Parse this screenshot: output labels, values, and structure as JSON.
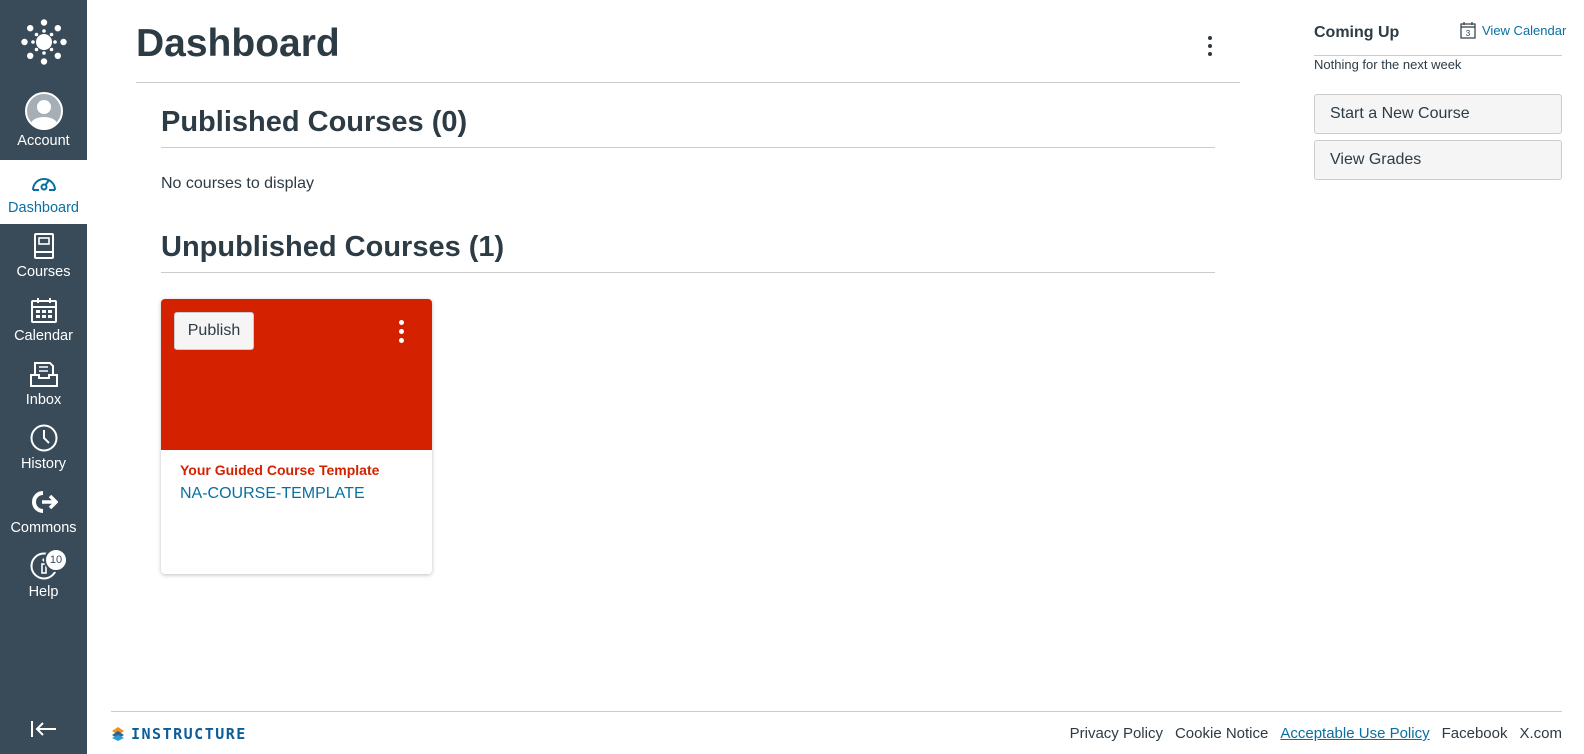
{
  "nav": {
    "account": "Account",
    "dashboard": "Dashboard",
    "courses": "Courses",
    "calendar": "Calendar",
    "inbox": "Inbox",
    "history": "History",
    "commons": "Commons",
    "help": "Help",
    "help_badge": "10"
  },
  "main": {
    "title": "Dashboard",
    "published_heading": "Published Courses (0)",
    "published_empty": "No courses to display",
    "unpublished_heading": "Unpublished Courses (1)"
  },
  "course_card": {
    "publish_label": "Publish",
    "title": "Your Guided Course Template",
    "code": "NA-COURSE-TEMPLATE",
    "color": "#d42200"
  },
  "sidebar_right": {
    "coming_up": "Coming Up",
    "calendar_day": "3",
    "view_calendar": "View Calendar",
    "nothing": "Nothing for the next week",
    "start_course": "Start a New Course",
    "view_grades": "View Grades"
  },
  "footer": {
    "logo_text": "INSTRUCTURE",
    "links": [
      "Privacy Policy",
      "Cookie Notice",
      "Acceptable Use Policy",
      "Facebook",
      "X.com"
    ]
  },
  "colors": {
    "nav_bg": "#394b58",
    "accent": "#0770a3"
  }
}
